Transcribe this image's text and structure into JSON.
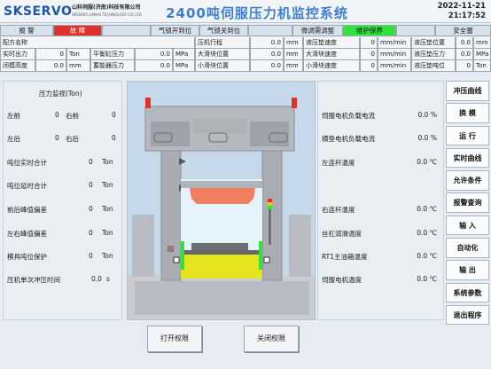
{
  "header": {
    "logo": "SKSERVO",
    "company_cn": "山科伺服(济南)科技有限公司",
    "company_en": "SKSERVO LINHAI TECHNOLOGY CO.,LTD",
    "title": "2400吨伺服压力机监控系统",
    "date": "2022-11-21",
    "time": "21:17:52"
  },
  "status": {
    "alarm_label": "报 警",
    "alarm_value": "故 障",
    "alarm_color": "#e0302a",
    "lock_open": "气锁开到位",
    "lock_close": "气锁关到位",
    "fine_adjust": "微调需调整",
    "maintenance": "维护保养",
    "maintenance_color": "#2ee43a",
    "safety": "安全塞"
  },
  "params": {
    "row1": [
      {
        "label": "配方名称",
        "value": "",
        "unit": ""
      },
      {
        "label": "压机行程",
        "value": "0.0",
        "unit": "mm"
      },
      {
        "label": "液压垫速度",
        "value": "0",
        "unit": "mm/min"
      },
      {
        "label": "液压垫位置",
        "value": "0.0",
        "unit": "mm"
      }
    ],
    "row2": [
      {
        "label": "实时出力",
        "value": "0",
        "unit": "Ton"
      },
      {
        "label": "平衡缸压力",
        "value": "0.0",
        "unit": "MPa"
      },
      {
        "label": "大滑块位置",
        "value": "0.0",
        "unit": "mm"
      },
      {
        "label": "大滑块速度",
        "value": "0",
        "unit": "mm/min"
      },
      {
        "label": "液压垫压力",
        "value": "0.0",
        "unit": "MPa"
      }
    ],
    "row3": [
      {
        "label": "闭模高度",
        "value": "0.0",
        "unit": "mm"
      },
      {
        "label": "蓄能器压力",
        "value": "0.0",
        "unit": "MPa"
      },
      {
        "label": "小滑块位置",
        "value": "0.0",
        "unit": "mm"
      },
      {
        "label": "小滑块速度",
        "value": "0",
        "unit": "mm/min"
      },
      {
        "label": "液压垫吨位",
        "value": "0",
        "unit": "Ton"
      }
    ]
  },
  "pressure": {
    "title": "压力监视(Ton)",
    "left_front_label": "左前",
    "left_front": "0",
    "right_front_label": "右前",
    "right_front": "0",
    "left_back_label": "左后",
    "left_back": "0",
    "right_back_label": "右后",
    "right_back": "0",
    "rows": [
      {
        "label": "吨位实时合计",
        "value": "0",
        "unit": "Ton"
      },
      {
        "label": "吨位延时合计",
        "value": "0",
        "unit": "Ton"
      },
      {
        "label": "前后峰值偏差",
        "value": "0",
        "unit": "Ton"
      },
      {
        "label": "左右峰值偏差",
        "value": "0",
        "unit": "Ton"
      },
      {
        "label": "模具吨位保护",
        "value": "0",
        "unit": "Ton"
      },
      {
        "label": "压机单次冲压时间",
        "value": "0.0",
        "unit": "s"
      }
    ]
  },
  "right_data": [
    {
      "label": "伺服电机负载电流",
      "value": "0.0",
      "unit": "%"
    },
    {
      "label": "横垫电机负载电流",
      "value": "0.0",
      "unit": "%"
    },
    {
      "label": "左连杆温度",
      "value": "0.0",
      "unit": "℃"
    },
    {
      "label": "右连杆温度",
      "value": "0.0",
      "unit": "℃"
    },
    {
      "label": "丝杠润滑温度",
      "value": "0.0",
      "unit": "℃"
    },
    {
      "label": "RT1主油箱温度",
      "value": "0.0",
      "unit": "℃"
    },
    {
      "label": "伺服电机温度",
      "value": "0.0",
      "unit": "℃"
    }
  ],
  "side_buttons": [
    "冲压曲线",
    "换 模",
    "运 行",
    "实时曲线",
    "允许条件",
    "报警查询",
    "输 入",
    "自动化",
    "输 出",
    "系统参数",
    "退出程序"
  ],
  "bottom_buttons": {
    "open": "打开权限",
    "close": "关闭权限"
  }
}
